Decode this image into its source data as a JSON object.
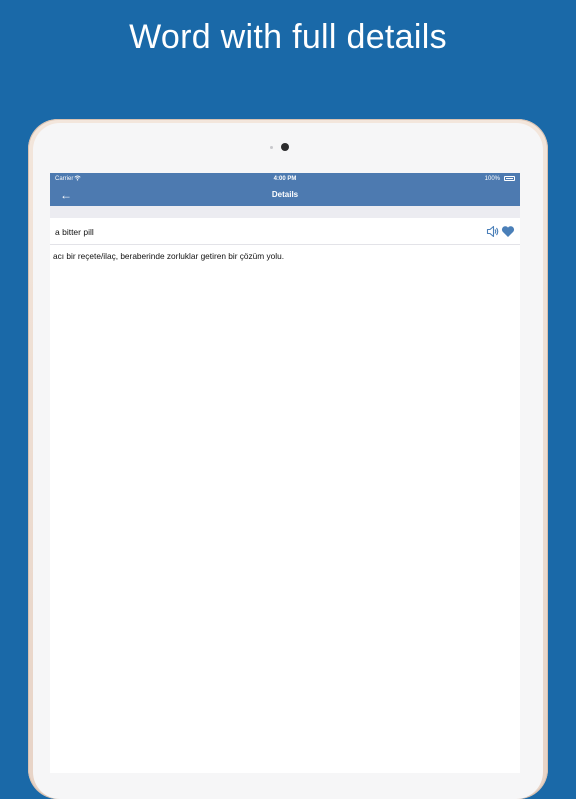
{
  "headline": "Word with full details",
  "status_bar": {
    "carrier": "Carrier",
    "wifi_icon": "wifi-icon",
    "time": "4:00 PM",
    "battery": "100%"
  },
  "nav": {
    "back_icon": "arrow-left-icon",
    "back_glyph": "←",
    "title": "Details"
  },
  "entry": {
    "word": "a bitter pill",
    "definition": "acı bir reçete/ilaç, beraberinde zorluklar getiren bir çözüm yolu.",
    "speaker_icon": "speaker-icon",
    "favorite_icon": "heart-icon",
    "favorited": true
  },
  "colors": {
    "page_background": "#1a69a8",
    "nav_bar": "#4d7ab0",
    "icon_accent": "#4a7fb8"
  }
}
